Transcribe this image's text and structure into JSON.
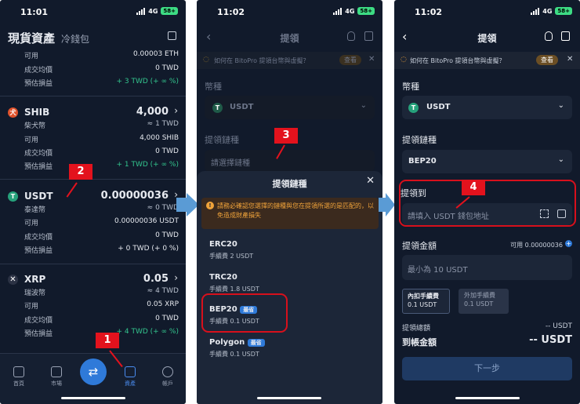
{
  "status": {
    "time1": "11:01",
    "time2": "11:02",
    "time3": "11:02",
    "network": "4G",
    "battery": "58+"
  },
  "screen1": {
    "title": "現貨資產",
    "subtitle": "冷錢包",
    "top": {
      "avail_label": "可用",
      "avail_value": "0.00003 ETH",
      "avg_label": "成交均價",
      "avg_value": "0 TWD",
      "pnl_label": "預估損益",
      "pnl_value": "+ 3 TWD (+ ∞ %)"
    },
    "assets": [
      {
        "symbol": "SHIB",
        "amount": "4,000",
        "name": "柴犬幣",
        "twd": "≈ 1 TWD",
        "avail_label": "可用",
        "avail": "4,000 SHIB",
        "avg_label": "成交均價",
        "avg": "0 TWD",
        "pnl_label": "預估損益",
        "pnl": "+ 1 TWD (+ ∞ %)"
      },
      {
        "symbol": "USDT",
        "amount": "0.00000036",
        "name": "泰達幣",
        "twd": "≈ 0 TWD",
        "avail_label": "可用",
        "avail": "0.00000036 USDT",
        "avg_label": "成交均價",
        "avg": "0 TWD",
        "pnl_label": "預估損益",
        "pnl": "+ 0 TWD (+ 0 %)"
      },
      {
        "symbol": "XRP",
        "amount": "0.05",
        "name": "瑞波幣",
        "twd": "≈ 4 TWD",
        "avail_label": "可用",
        "avail": "0.05 XRP",
        "avg_label": "成交均價",
        "avg": "0 TWD",
        "pnl_label": "預估損益",
        "pnl": "+ 4 TWD (+ ∞ %)"
      }
    ],
    "nav": [
      "首頁",
      "市場",
      "",
      "資產",
      "帳戶"
    ]
  },
  "screen2": {
    "title": "提領",
    "banner": "如何在 BitoPro 提領台幣與虛擬？",
    "banner_btn": "查看",
    "currency_label": "幣種",
    "currency": "USDT",
    "chain_label": "提領鏈種",
    "chain_placeholder": "請選擇鏈種",
    "sheet_title": "提領鏈種",
    "warning": "請務必確認您選擇的鏈種與您在提領所選的是匹配的，以免造成財產損失",
    "chains": [
      {
        "name": "ERC20",
        "fee": "手續費 2 USDT",
        "tag": ""
      },
      {
        "name": "TRC20",
        "fee": "手續費 1.8 USDT",
        "tag": ""
      },
      {
        "name": "BEP20",
        "fee": "手續費 0.1 USDT",
        "tag": "最省"
      },
      {
        "name": "Polygon",
        "fee": "手續費 0.1 USDT",
        "tag": "最省"
      }
    ]
  },
  "screen3": {
    "title": "提領",
    "banner": "如何在 BitoPro 提領台幣與虛擬？",
    "banner_btn": "查看",
    "currency_label": "幣種",
    "currency": "USDT",
    "chain_label": "提領鏈種",
    "chain": "BEP20",
    "to_label": "提領到",
    "to_placeholder": "請填入 USDT 錢包地址",
    "amount_label": "提領金額",
    "available": "可用 0.00000036",
    "amount_placeholder": "最小為 10 USDT",
    "fee_inner": "內扣手續費",
    "fee_inner_val": "0.1 USDT",
    "fee_outer": "外加手續費",
    "fee_outer_val": "0.1 USDT",
    "total_label": "提領總額",
    "total_val": "-- USDT",
    "received_label": "到帳金額",
    "received_val": "-- USDT",
    "next_btn": "下一步"
  },
  "steps": [
    "1",
    "2",
    "3",
    "4"
  ],
  "colors": {
    "bg": "#111a2b",
    "accent": "#e3121d",
    "green": "#33c48d",
    "usdt": "#26a17b",
    "blue": "#2f7ad9",
    "arrow": "#5a9bd5"
  }
}
